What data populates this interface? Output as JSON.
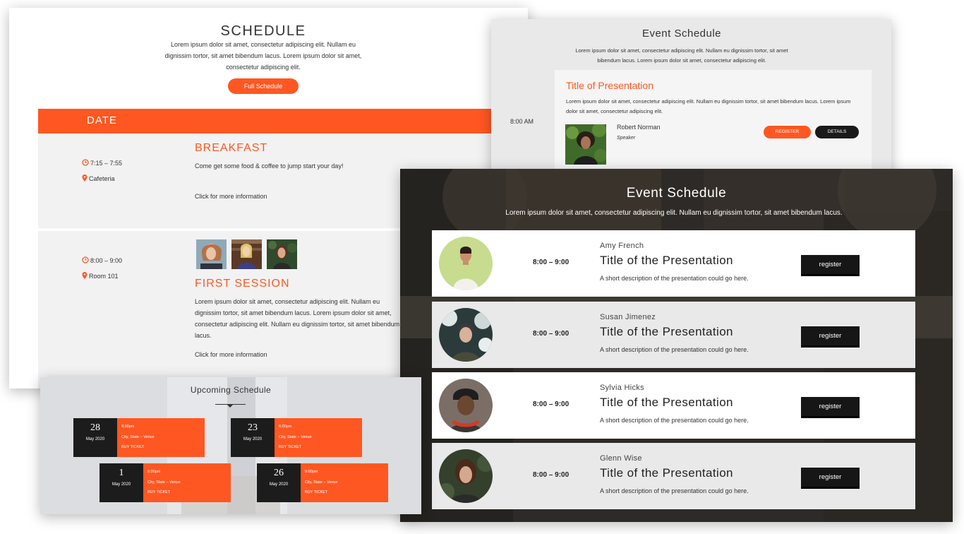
{
  "colors": {
    "accent": "#ff5722",
    "dark": "#1a1a1a",
    "panel_light": "#f2f2f2"
  },
  "schedule": {
    "title": "SCHEDULE",
    "intro": "Lorem ipsum dolor sit amet, consectetur adipiscing elit. Nullam eu dignissim tortor, sit amet bibendum lacus. Lorem ipsum dolor sit amet, consectetur adipiscing elit.",
    "full_button": "Full Schedule",
    "date_header": "DATE",
    "items": [
      {
        "time": "7:15 – 7:55",
        "location": "Cafeteria",
        "title": "BREAKFAST",
        "description": "Come get some food & coffee to jump start your day!",
        "more": "Click for more information"
      },
      {
        "time": "8:00 – 9:00",
        "location": "Room 101",
        "title": "FIRST SESSION",
        "description": "Lorem ipsum dolor sit amet, consectetur adipiscing elit. Nullam eu dignissim tortor, sit amet bibendum lacus. Lorem ipsum dolor sit amet, consectetur adipiscing elit. Nullam eu dignissim tortor, sit amet bibendum lacus.",
        "more": "Click for more information"
      }
    ]
  },
  "event_light": {
    "title": "Event Schedule",
    "intro": "Lorem ipsum dolor sit amet, consectetur adipiscing elit. Nullam eu dignissim tortor, sit amet bibendum lacus. Lorem ipsum dolor sit amet, consectetur adipiscing elit.",
    "time": "8:00 AM",
    "card_title": "Title of Presentation",
    "card_desc": "Lorem ipsum dolor sit amet, consectetur adipiscing elit. Nullam eu dignissim tortor, sit amet bibendum lacus. Lorem ipsum dolor sit amet, consectetur adipiscing elit.",
    "speaker": "Robert Norman",
    "role": "Speaker",
    "register": "REGISTER",
    "details": "DETAILS"
  },
  "event_dark": {
    "title": "Event Schedule",
    "intro": "Lorem ipsum dolor sit amet, consectetur adipiscing elit. Nullam eu dignissim tortor, sit amet bibendum lacus.",
    "rows": [
      {
        "name": "Amy French",
        "time": "8:00 – 9:00",
        "title": "Title of the Presentation",
        "desc": "A short description of the presentation could go here.",
        "button": "register"
      },
      {
        "name": "Susan Jimenez",
        "time": "8:00 – 9:00",
        "title": "Title of the Presentation",
        "desc": "A short description of the presentation could go here.",
        "button": "register"
      },
      {
        "name": "Sylvia Hicks",
        "time": "8:00 – 9:00",
        "title": "Title of the Presentation",
        "desc": "A short description of the presentation could go here.",
        "button": "register"
      },
      {
        "name": "Glenn Wise",
        "time": "8:00 – 9:00",
        "title": "Title of the Presentation",
        "desc": "A short description of the presentation could go here.",
        "button": "register"
      }
    ]
  },
  "upcoming": {
    "title": "Upcoming Schedule",
    "events": [
      {
        "day": "28",
        "month": "May 2020",
        "time": "6:00pm",
        "venue": "City, State – Venue",
        "buy": "BUY TICKET"
      },
      {
        "day": "23",
        "month": "May 2020",
        "time": "6:00pm",
        "venue": "City, State – Venue",
        "buy": "BUY TICKET"
      },
      {
        "day": "1",
        "month": "May 2020",
        "time": "6:00pm",
        "venue": "City, State – Venue",
        "buy": "BUY TICKET"
      },
      {
        "day": "26",
        "month": "May 2020",
        "time": "9:00pm",
        "venue": "City, State – Venue",
        "buy": "BUY TICKET"
      }
    ]
  }
}
